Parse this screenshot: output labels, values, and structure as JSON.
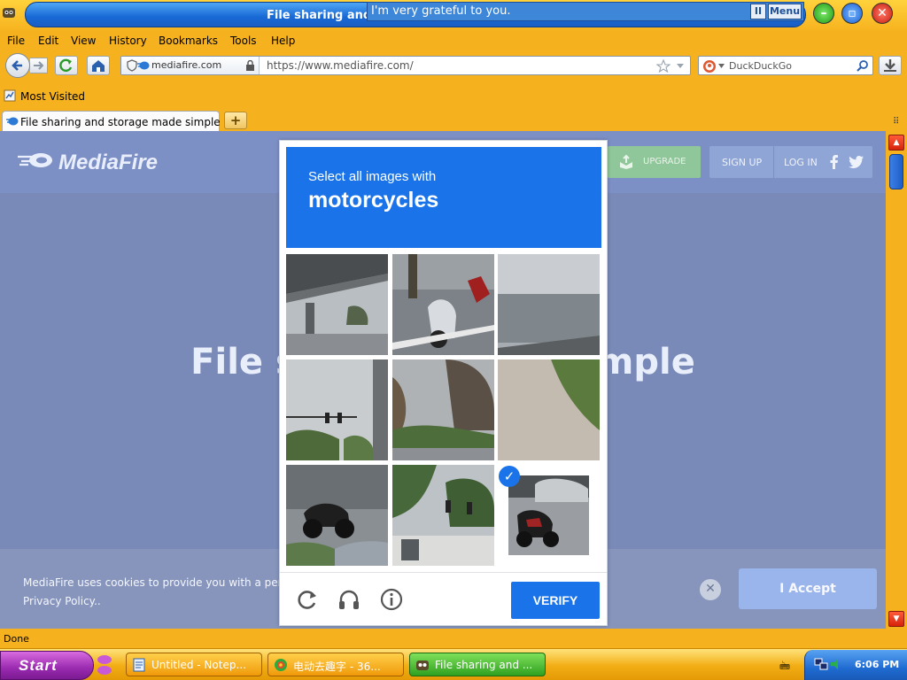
{
  "window": {
    "title": "File sharing and storage made simple - Mozilla Firefox",
    "overlay_text": "I'm very grateful to you.",
    "overlay_menu": "Menu",
    "overlay_pause": "II"
  },
  "menu": [
    {
      "label": "File"
    },
    {
      "label": "Edit"
    },
    {
      "label": "View"
    },
    {
      "label": "History"
    },
    {
      "label": "Bookmarks"
    },
    {
      "label": "Tools"
    },
    {
      "label": "Help"
    }
  ],
  "navbar": {
    "identity_domain": "mediafire.com",
    "url": "https://www.mediafire.com/",
    "search_engine": "DuckDuckGo"
  },
  "bookmarks": {
    "most_visited": "Most Visited"
  },
  "tabs": [
    {
      "label": "File sharing and storage made simple"
    }
  ],
  "page": {
    "logo": "MediaFire",
    "upgrade": "UPGRADE",
    "signup": "SIGN UP",
    "login": "LOG IN",
    "hero": "File storage made simple",
    "cookie_text": "MediaFire uses cookies to provide you with a personalized experience. By using our services you agree to our Privacy Policy..",
    "cookie_accept": "I Accept"
  },
  "captcha": {
    "prompt": "Select all images with",
    "object": "motorcycles",
    "verify": "VERIFY",
    "tiles": [
      {
        "desc": "overpass",
        "selected": false
      },
      {
        "desc": "parked motorcycle",
        "selected": false
      },
      {
        "desc": "water",
        "selected": false
      },
      {
        "desc": "traffic lights",
        "selected": false
      },
      {
        "desc": "trees and street",
        "selected": false
      },
      {
        "desc": "grass and gravel",
        "selected": false
      },
      {
        "desc": "scooter",
        "selected": false
      },
      {
        "desc": "traffic light with trees",
        "selected": false
      },
      {
        "desc": "motorcycle near car",
        "selected": true
      }
    ]
  },
  "status": {
    "text": "Done"
  },
  "taskbar": {
    "start": "Start",
    "tasks": [
      {
        "label": "Untitled - Notep...",
        "active": false
      },
      {
        "label": "电动去趣字 - 36...",
        "active": false
      },
      {
        "label": "File sharing and ...",
        "active": true
      }
    ],
    "clock": "6:06 PM"
  },
  "colors": {
    "captcha_blue": "#1a73e8",
    "chrome_orange": "#f6b21e",
    "page_overlay": "#7a8ab8"
  }
}
